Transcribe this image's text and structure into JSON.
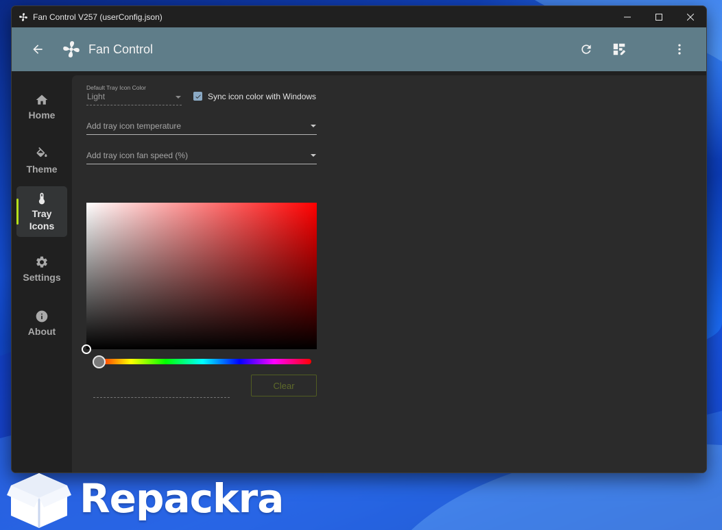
{
  "window": {
    "title": "Fan Control V257 (userConfig.json)"
  },
  "appbar": {
    "title": "Fan Control",
    "actions": [
      "refresh-icon",
      "dashboard-edit-icon",
      "more-vert-icon"
    ]
  },
  "sidebar": {
    "items": [
      {
        "label": "Home",
        "icon": "home-icon",
        "active": false
      },
      {
        "label": "Theme",
        "icon": "paint-bucket-icon",
        "active": false
      },
      {
        "label": "Tray Icons",
        "line1": "Tray",
        "line2": "Icons",
        "icon": "thermometer-icon",
        "active": true
      },
      {
        "label": "Settings",
        "icon": "gear-icon",
        "active": false
      },
      {
        "label": "About",
        "icon": "info-icon",
        "active": false
      }
    ],
    "active_indicator_color": "#b6e11a"
  },
  "tray": {
    "default_color_label": "Default Tray Icon Color",
    "default_color_value": "Light",
    "sync_label": "Sync icon color with Windows",
    "sync_checked": true,
    "temperature_placeholder": "Add tray icon temperature",
    "fan_speed_placeholder": "Add tray icon fan speed (%)",
    "hue": 0,
    "clear_label": "Clear"
  },
  "colors": {
    "appbar": "#5f7d89",
    "background": "#2b2b2b",
    "accent": "#b6e11a"
  },
  "watermark": {
    "text": "Repackra"
  }
}
